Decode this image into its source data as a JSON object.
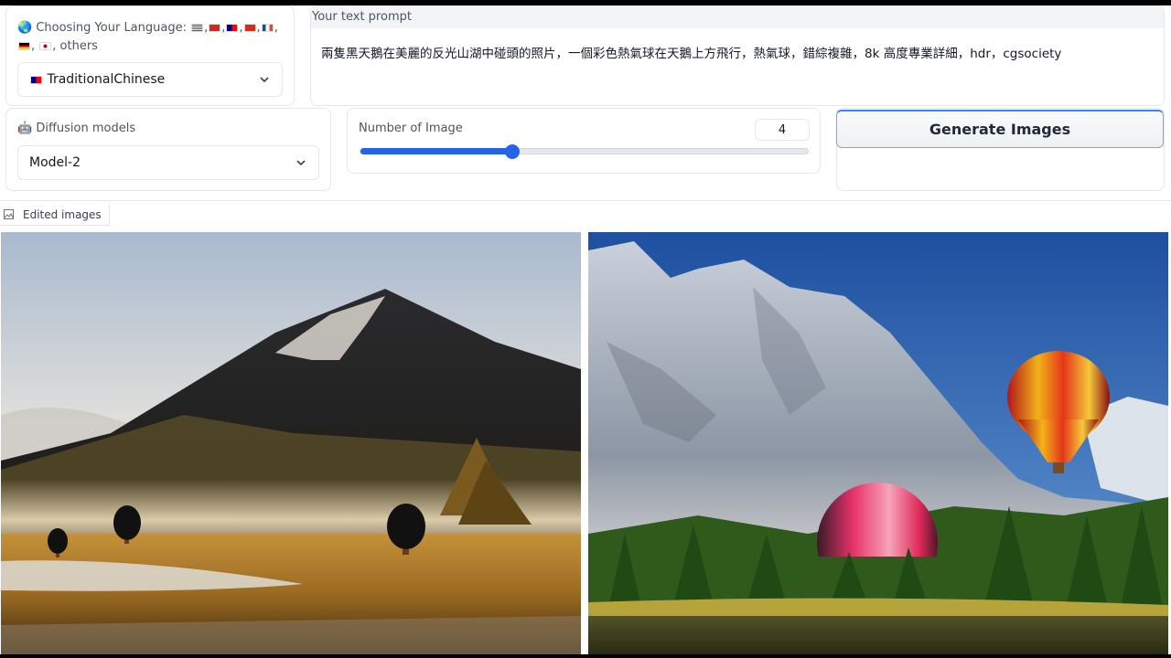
{
  "language": {
    "label_prefix": "Choosing Your Language:",
    "label_suffix": ", others",
    "selected": "TraditionalChinese"
  },
  "prompt": {
    "label": "Your text prompt",
    "value": "兩隻黑天鵝在美麗的反光山湖中碰頭的照片，一個彩色熱氣球在天鵝上方飛行，熱氣球，錯綜複雜，8k 高度專業詳細，hdr，cgsociety"
  },
  "models": {
    "label": "Diffusion models",
    "selected": "Model-2"
  },
  "num_images": {
    "label": "Number of Image",
    "value": "4",
    "fraction": 0.34
  },
  "generate": {
    "label": "Generate Images"
  },
  "gallery": {
    "tab_label": "Edited images"
  },
  "colors": {
    "accent": "#2563eb",
    "border": "#e5e7eb"
  }
}
